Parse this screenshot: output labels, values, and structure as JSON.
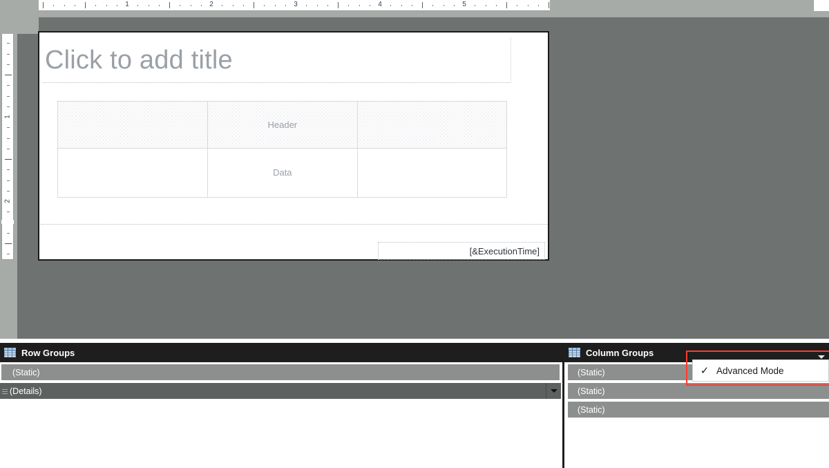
{
  "ruler": {
    "horizontal": {
      "labels": [
        "1",
        "2",
        "3",
        "4",
        "5"
      ],
      "unit": "inches"
    },
    "vertical": {
      "labels": [
        "1",
        "2"
      ],
      "unit": "inches"
    }
  },
  "report": {
    "title_placeholder": "Click to add title",
    "tablix": {
      "header_row": [
        "",
        "Header",
        ""
      ],
      "data_row": [
        "",
        "Data",
        ""
      ]
    },
    "footer": {
      "execution_time_expression": "[&ExecutionTime]"
    }
  },
  "row_groups": {
    "title": "Row Groups",
    "icon": "grid-icon",
    "rows": [
      {
        "label": "(Static)",
        "indented": true,
        "has_handle": false,
        "has_dropdown": false
      },
      {
        "label": "(Details)",
        "indented": false,
        "has_handle": true,
        "has_dropdown": true
      }
    ]
  },
  "column_groups": {
    "title": "Column Groups",
    "icon": "grid-icon",
    "rows": [
      {
        "label": "(Static)"
      },
      {
        "label": "(Static)"
      },
      {
        "label": "(Static)"
      }
    ]
  },
  "context_menu": {
    "items": [
      {
        "label": "Advanced Mode",
        "checked": true,
        "check_glyph": "✓"
      }
    ],
    "highlight_color": "#ff3b30",
    "dropdown_glyph": "▼"
  }
}
